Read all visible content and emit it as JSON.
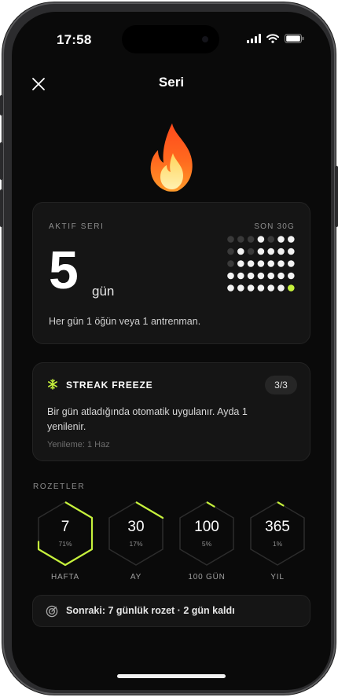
{
  "status_bar": {
    "time": "17:58"
  },
  "header": {
    "title": "Seri",
    "close_icon": "close-icon"
  },
  "hero": {
    "icon": "fire-icon"
  },
  "active_streak": {
    "label": "AKTIF SERI",
    "range_label": "SON 30G",
    "count": "5",
    "unit": "gün",
    "description": "Her gün 1 öğün veya 1 antrenman."
  },
  "streak_freeze": {
    "icon": "snowflake-icon",
    "title": "STREAK FREEZE",
    "count": "3/3",
    "description": "Bir gün atladığında otomatik uygulanır. Ayda 1 yenilenir.",
    "renewal": "Yenileme: 1 Haz"
  },
  "badges": {
    "label": "ROZETLER",
    "items": [
      {
        "value": "7",
        "percent": "71%",
        "name": "HAFTA",
        "progress": 0.71
      },
      {
        "value": "30",
        "percent": "17%",
        "name": "AY",
        "progress": 0.17
      },
      {
        "value": "100",
        "percent": "5%",
        "name": "100 GÜN",
        "progress": 0.05
      },
      {
        "value": "365",
        "percent": "1%",
        "name": "YIL",
        "progress": 0.01
      }
    ]
  },
  "next": {
    "icon": "target-icon",
    "text": "Sonraki: 7 günlük rozet · 2 gün kaldı"
  },
  "colors": {
    "accent": "#c6f13c",
    "background": "#0a0a0a",
    "card": "#151515"
  }
}
